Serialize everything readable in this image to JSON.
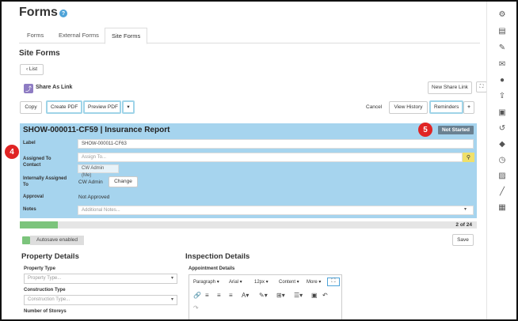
{
  "page": {
    "title": "Forms"
  },
  "tabs": [
    "Forms",
    "External Forms",
    "Site Forms"
  ],
  "site_forms": {
    "heading": "Site Forms",
    "list_button": "List",
    "share_link": "Share As Link",
    "new_share_link": "New Share Link",
    "copy": "Copy",
    "create_pdf": "Create PDF",
    "preview_pdf": "Preview PDF",
    "cancel": "Cancel",
    "view_history": "View History",
    "reminders": "Reminders"
  },
  "form": {
    "title": "SHOW-000011-CF59 | Insurance Report",
    "status": "Not Started",
    "label_label": "Label",
    "label_value": "SHOW-000011-CF63",
    "assigned_to_label": "Assigned To Contact",
    "assigned_to_placeholder": "Assign To...",
    "assigned_chip": "CW Admin (Me)",
    "internal_label": "Internally Assigned To",
    "internal_value": "CW Admin",
    "change_button": "Change",
    "approval_label": "Approval",
    "approval_value": "Not Approved",
    "notes_label": "Notes",
    "notes_placeholder": "Additional Notes..."
  },
  "progress": {
    "label": "2 of 24",
    "fraction": 0.0833
  },
  "autosave": {
    "label": "Autosave enabled"
  },
  "save_button": "Save",
  "property": {
    "title": "Property Details",
    "type_label": "Property Type",
    "type_placeholder": "Property Type...",
    "construction_label": "Construction Type",
    "construction_placeholder": "Construction Type...",
    "storeys_label": "Number of Storeys"
  },
  "inspection": {
    "title": "Inspection Details",
    "appointment_label": "Appointment Details",
    "toolbar": {
      "paragraph": "Paragraph",
      "font": "Arial",
      "size": "12px",
      "content": "Content",
      "more": "More"
    }
  },
  "callouts": {
    "left": "4",
    "right": "5"
  },
  "icons": {
    "sidebar": [
      "gear-icon",
      "note-icon",
      "edit-icon",
      "mail-icon",
      "chat-icon",
      "upload-icon",
      "contact-icon",
      "history-icon",
      "bell-icon",
      "clock-icon",
      "image-icon",
      "brush-icon",
      "calculator-icon"
    ]
  },
  "colors": {
    "panel": "#a6d4ee",
    "accent": "#4ea3d8",
    "progress": "#7cc47c",
    "badge": "#e02424"
  }
}
